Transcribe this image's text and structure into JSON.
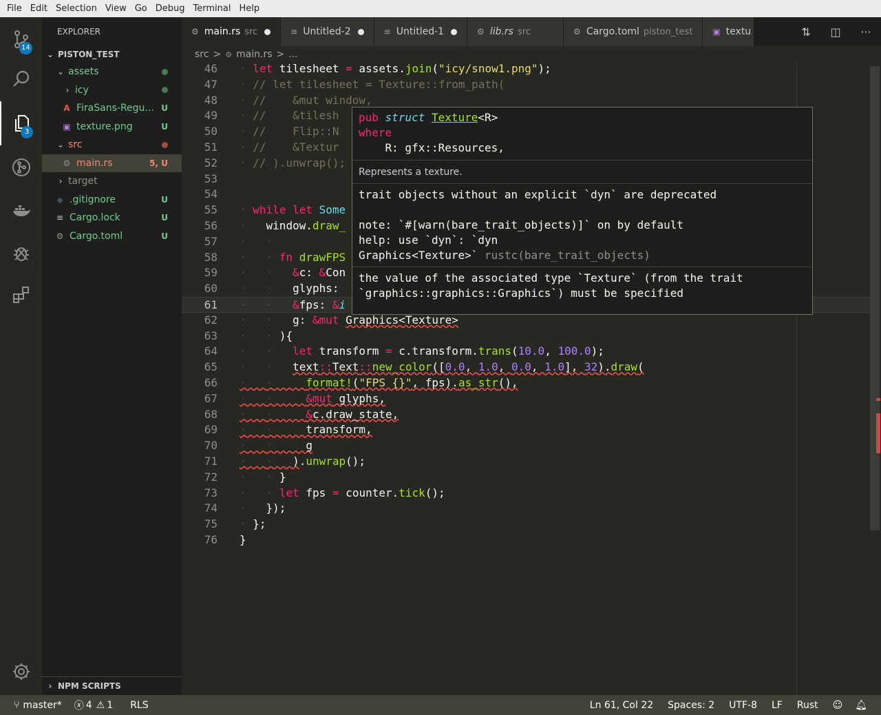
{
  "menu": [
    "File",
    "Edit",
    "Selection",
    "View",
    "Go",
    "Debug",
    "Terminal",
    "Help"
  ],
  "activity": {
    "scm_badge": "14",
    "explorer_badge": "3"
  },
  "explorer": {
    "title": "EXPLORER",
    "project": "PISTON_TEST",
    "npm": "NPM SCRIPTS",
    "items": [
      {
        "label": "assets",
        "status": "",
        "kind": "folder-open",
        "depth": 1
      },
      {
        "label": "icy",
        "status": "",
        "kind": "folder-closed",
        "depth": 2
      },
      {
        "label": "FiraSans-Regu...",
        "status": "U",
        "kind": "font",
        "depth": 2
      },
      {
        "label": "texture.png",
        "status": "U",
        "kind": "image",
        "depth": 2
      },
      {
        "label": "src",
        "status": "",
        "kind": "folder-open",
        "depth": 1
      },
      {
        "label": "main.rs",
        "status": "5, U",
        "kind": "rust",
        "depth": 2
      },
      {
        "label": "target",
        "status": "",
        "kind": "folder-closed",
        "depth": 1
      },
      {
        "label": ".gitignore",
        "status": "U",
        "kind": "git",
        "depth": 1
      },
      {
        "label": "Cargo.lock",
        "status": "U",
        "kind": "doc",
        "depth": 1
      },
      {
        "label": "Cargo.toml",
        "status": "U",
        "kind": "gear",
        "depth": 1
      }
    ]
  },
  "tabs": [
    {
      "label": "main.rs",
      "desc": "src",
      "modified": true,
      "active": true
    },
    {
      "label": "Untitled-2",
      "desc": "",
      "modified": true,
      "active": false
    },
    {
      "label": "Untitled-1",
      "desc": "",
      "modified": true,
      "active": false
    },
    {
      "label": "lib.rs",
      "desc": "src",
      "modified": false,
      "active": false
    },
    {
      "label": "Cargo.toml",
      "desc": "piston_test",
      "modified": false,
      "active": false
    },
    {
      "label": "textu",
      "desc": "",
      "modified": false,
      "active": false
    }
  ],
  "breadcrumb": [
    "src",
    ">",
    "main.rs",
    ">",
    "..."
  ],
  "editor": {
    "line_numbers": [
      "46",
      "47",
      "48",
      "49",
      "50",
      "51",
      "52",
      "53",
      "54",
      "55",
      "56",
      "57",
      "58",
      "59",
      "60",
      "61",
      "62",
      "63",
      "64",
      "65",
      "66",
      "67",
      "68",
      "69",
      "70",
      "71",
      "72",
      "73",
      "74",
      "75",
      "76"
    ]
  },
  "hover": {
    "sig_kw": "pub",
    "sig_struct": "struct",
    "sig_name": "Texture",
    "sig_generic": "<R>",
    "sig_where": "where",
    "sig_bound": "    R: gfx::Resources,",
    "doc": "Represents a texture.",
    "err1_a": "trait objects without an explicit `dyn` are deprecated",
    "err1_b": "note: `#[warn(bare_trait_objects)]` on by default",
    "err1_c": "help: use `dyn`: `dyn",
    "err1_d": "Graphics<Texture>`",
    "err1_e": " rustc(bare_trait_objects)",
    "err2_a": "the value of the associated type `Texture` (from the trait",
    "err2_b": "`graphics::graphics::Graphics`) must be specified"
  },
  "status": {
    "branch": "master*",
    "errors": "4",
    "warnings": "1",
    "rls": "RLS",
    "position": "Ln 61, Col 22",
    "spaces": "Spaces: 2",
    "encoding": "UTF-8",
    "eol": "LF",
    "language": "Rust"
  },
  "colors": {
    "editor_bg": "#272822",
    "sidebar_bg": "#1e1f1c",
    "status_bg": "#414339",
    "keyword": "#f92672",
    "function": "#a6e22e",
    "string": "#e6db74",
    "number": "#ae81ff",
    "comment": "#75715e",
    "git_untracked": "#73c991",
    "git_error": "#f48771"
  }
}
